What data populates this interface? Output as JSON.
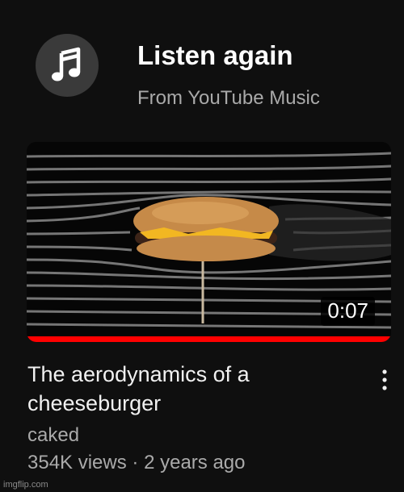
{
  "shelf": {
    "title": "Listen again",
    "subtitle": "From YouTube Music",
    "icon": "music-note-icon"
  },
  "video": {
    "title": "The aerodynamics of a cheeseburger",
    "channel": "caked",
    "views": "354K views",
    "separator": "·",
    "age": "2 years ago",
    "duration": "0:07",
    "watch_progress": 1.0,
    "menu_icon": "kebab-menu-icon"
  },
  "watermark": "imgflip.com",
  "colors": {
    "background": "#0f0f0f",
    "progress": "#ff0000",
    "avatar": "#3a3a3a"
  }
}
